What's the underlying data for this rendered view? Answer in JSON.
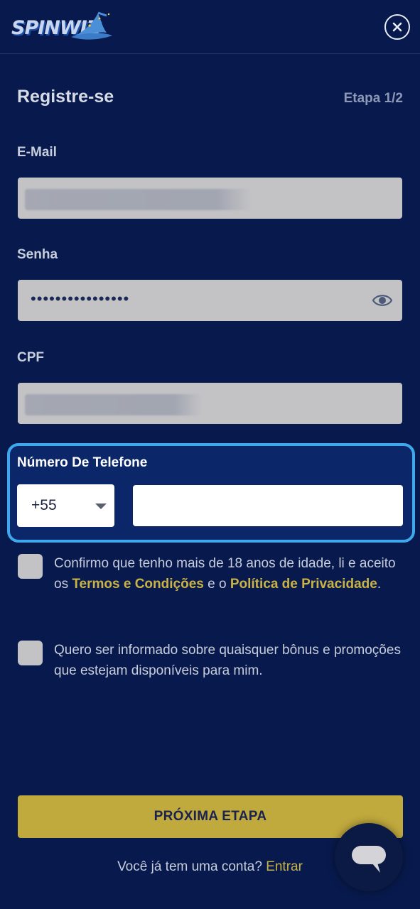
{
  "header": {
    "logo_text": "SPINWIZ",
    "close_icon": "close-icon"
  },
  "form": {
    "title": "Registre-se",
    "step": "Etapa 1/2",
    "email": {
      "label": "E-Mail",
      "value": ""
    },
    "password": {
      "label": "Senha",
      "value": "••••••••••••••••",
      "toggle_icon": "eye-icon"
    },
    "cpf": {
      "label": "CPF",
      "value": ""
    },
    "phone": {
      "label": "Número De Telefone",
      "country_code": "+55",
      "value": ""
    },
    "age_consent": {
      "text_before": "Confirmo que tenho mais de 18 anos de idade, li e aceito os ",
      "terms_link": "Termos e Condições",
      "text_middle": " e o ",
      "privacy_link": "Política de Privacidade",
      "text_after": ".",
      "checked": false
    },
    "promo_consent": {
      "text": "Quero ser informado sobre quaisquer bônus e promoções que estejam disponíveis para mim.",
      "checked": false
    },
    "next_button": "PRÓXIMA ETAPA",
    "login_prompt": "Você já tem uma conta?",
    "login_link": "Entrar"
  },
  "chat": {
    "icon": "chat-bubble-icon"
  },
  "colors": {
    "background": "#081a4d",
    "accent_gold": "#c0a93d",
    "link_gold": "#c9b346",
    "focus_blue": "#3fa8ec",
    "field_grey": "#c3c3c6"
  }
}
